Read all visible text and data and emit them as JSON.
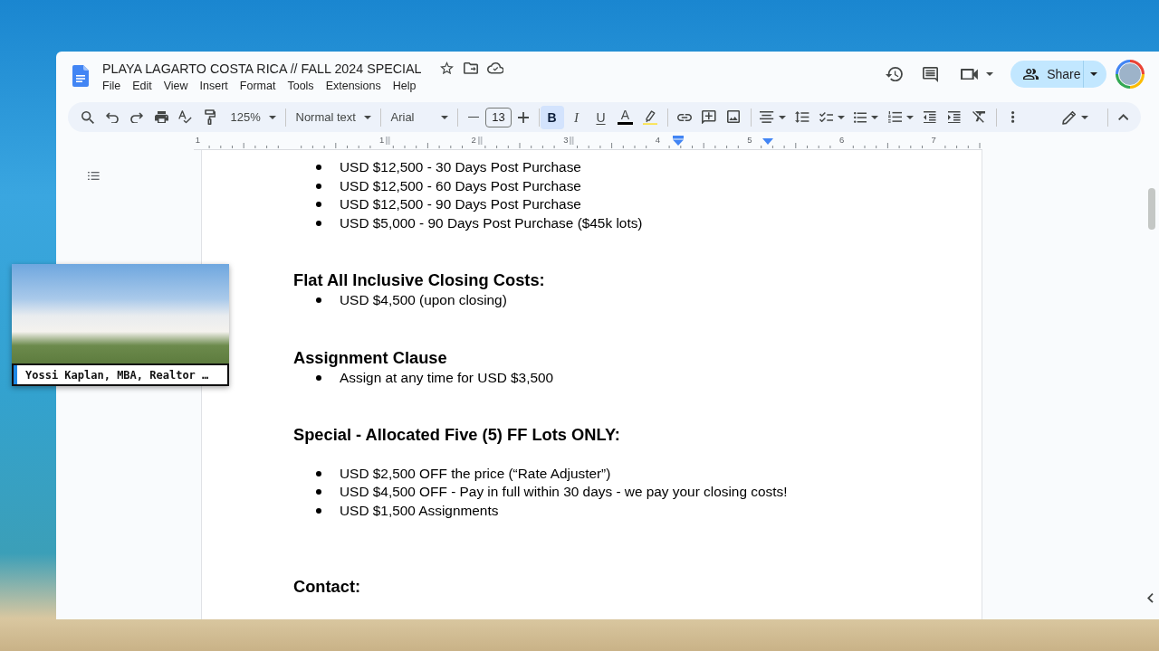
{
  "header": {
    "title": "PLAYA LAGARTO COSTA RICA // FALL 2024 SPECIAL",
    "menu": [
      "File",
      "Edit",
      "View",
      "Insert",
      "Format",
      "Tools",
      "Extensions",
      "Help"
    ],
    "share": "Share"
  },
  "toolbar": {
    "zoom": "125%",
    "paragraph_style": "Normal text",
    "font": "Arial",
    "font_size": "13",
    "format_buttons": [
      {
        "kind": "bold",
        "label": "B",
        "selected": true
      },
      {
        "kind": "italic",
        "label": "I",
        "selected": false
      },
      {
        "kind": "underline",
        "label": "U",
        "selected": false
      },
      {
        "kind": "text_color",
        "label": "A"
      }
    ]
  },
  "ruler": {
    "left_labels": [
      "1"
    ],
    "labels": [
      "1",
      "2",
      "3",
      "4",
      "5",
      "6",
      "7"
    ]
  },
  "document": {
    "blocks": [
      {
        "kind": "bullet",
        "text": "USD $12,500 - 30 Days Post Purchase"
      },
      {
        "kind": "bullet",
        "text": "USD $12,500 - 60 Days Post Purchase"
      },
      {
        "kind": "bullet",
        "text": "USD $12,500 - 90 Days Post Purchase"
      },
      {
        "kind": "bullet",
        "text": "USD $5,000 - 90 Days Post Purchase ($45k lots)"
      },
      {
        "kind": "blank"
      },
      {
        "kind": "blank"
      },
      {
        "kind": "heading",
        "text": "Flat All Inclusive Closing Costs:"
      },
      {
        "kind": "bullet",
        "text": "USD $4,500 (upon closing)"
      },
      {
        "kind": "blank"
      },
      {
        "kind": "blank"
      },
      {
        "kind": "heading",
        "text": "Assignment Clause"
      },
      {
        "kind": "bullet",
        "text": "Assign at any time for USD $3,500"
      },
      {
        "kind": "blank"
      },
      {
        "kind": "blank"
      },
      {
        "kind": "heading",
        "text": "Special - Allocated Five (5) FF Lots ONLY:"
      },
      {
        "kind": "blank"
      },
      {
        "kind": "bullet",
        "text": "USD $2,500 OFF the price (“Rate Adjuster”)"
      },
      {
        "kind": "bullet",
        "text": "USD $4,500 OFF - Pay in full within 30 days - we pay your closing costs!"
      },
      {
        "kind": "bullet",
        "text": "USD $1,500 Assignments"
      },
      {
        "kind": "blank"
      },
      {
        "kind": "blank"
      },
      {
        "kind": "blank"
      },
      {
        "kind": "heading",
        "text": "Contact:"
      }
    ]
  },
  "video_overlay": {
    "caption": "Yossi Kaplan, MBA, Realtor …"
  }
}
